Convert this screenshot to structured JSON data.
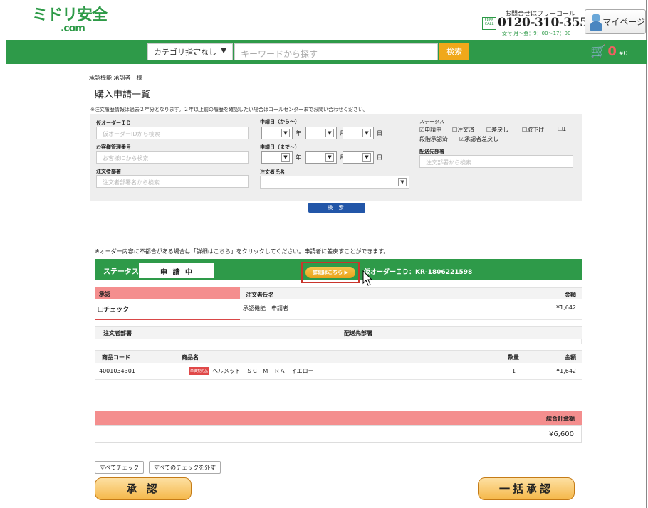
{
  "header": {
    "logo_main": "ミドリ安全",
    "logo_sub": ".com",
    "call_label": "お問合せはフリーコール",
    "free_call": "FREE CALL",
    "phone": "0120-310-355",
    "hours": "受付 月〜金：9：00〜17：00",
    "mypage_label": "マイページ"
  },
  "searchbar": {
    "category_value": "カテゴリ指定なし",
    "keyword_placeholder": "キーワードから探す",
    "search_label": "検索",
    "cart_count": "0",
    "cart_total": "¥0"
  },
  "page": {
    "user_line": "承認機能 承認者　様",
    "title": "購入申請一覧",
    "history_note": "※注文履歴情報は過去２年分となります。２年以上前の履歴を確認したい場合はコールセンターまでお問い合わせください。"
  },
  "search_form": {
    "temp_order_label": "仮オーダーＩＤ",
    "temp_order_placeholder": "仮オーダーIDから検索",
    "customer_no_label": "お客様管理番号",
    "customer_no_placeholder": "お客様IDから検索",
    "dept_label": "注文者部署",
    "dept_placeholder": "注文者部署名から検索",
    "date_from_label": "申請日（から〜）",
    "date_to_label": "申請日（まで〜）",
    "year": "年",
    "month": "月",
    "day": "日",
    "orderer_label": "注文者氏名",
    "status_label": "ステータス",
    "status_options": [
      {
        "label": "申請中",
        "checked": true
      },
      {
        "label": "注文済",
        "checked": false
      },
      {
        "label": "差戻し",
        "checked": false
      },
      {
        "label": "取下げ",
        "checked": false
      },
      {
        "label": "1",
        "checked": false
      }
    ],
    "status_line2_a": "段階承認済",
    "status_line2_b": "承認者差戻し",
    "ship_dept_label": "配送先部署",
    "ship_dept_placeholder": "注文部署から検索",
    "search_button": "検 索"
  },
  "notice": "※オーダー内容に不都合がある場合は「詳細はこちら」をクリックしてください。申請者に差戻すことができます。",
  "order": {
    "status_label": "ステータス：",
    "status_value": "申 請 中",
    "details_button": "詳細はこちら ▶",
    "order_id": "仮オーダーＩＤ：KR-1806221598",
    "approve_header": "承認",
    "orderer_header": "注文者氏名",
    "amount_header": "金額",
    "check_label": "チェック",
    "orderer_name": "承認機能　申請者",
    "amount": "¥1,642",
    "dept_header": "注文者部署",
    "ship_header": "配送先部署",
    "items_headers": {
      "code": "商品コード",
      "name": "商品名",
      "qty": "数量",
      "amount": "金額"
    },
    "items": [
      {
        "code": "4001034301",
        "badge": "単価契約品",
        "name": "ヘルメット　ＳＣ−Ｍ　ＲＡ　イエロー",
        "qty": "1",
        "amount": "¥1,642"
      }
    ]
  },
  "totals": {
    "label": "総合計金額",
    "value": "¥6,600"
  },
  "actions": {
    "check_all": "すべてチェック",
    "uncheck_all": "すべてのチェックを外す",
    "approve": "承 認",
    "bulk_approve": "一括承認"
  },
  "colors": {
    "brand_green": "#2e9a49",
    "accent_orange": "#f0a81a",
    "pink_header": "#f48e8e",
    "search_blue": "#2256a8"
  }
}
